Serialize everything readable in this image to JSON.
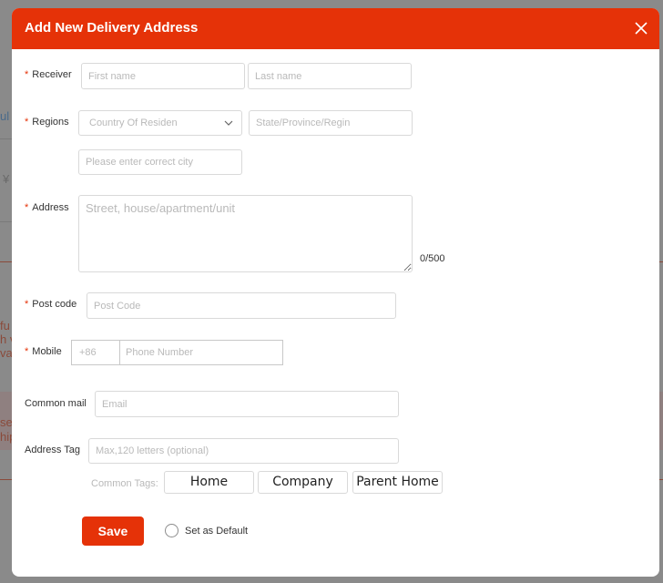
{
  "background": {
    "fragments": [
      "ul",
      "¥",
      "fu",
      "h v",
      "va",
      "se",
      "hip"
    ]
  },
  "modal": {
    "title": "Add New Delivery Address",
    "close_icon": "close-icon",
    "required_mark": "*",
    "receiver": {
      "label": "Receiver",
      "first_name_placeholder": "First name",
      "last_name_placeholder": "Last name"
    },
    "regions": {
      "label": "Regions",
      "country_placeholder": "Country Of Residen",
      "state_placeholder": "State/Province/Regin",
      "city_placeholder": "Please enter correct city"
    },
    "address": {
      "label": "Address",
      "placeholder": "Street, house/apartment/unit",
      "counter": "0/500"
    },
    "postcode": {
      "label": "Post code",
      "placeholder": "Post Code"
    },
    "mobile": {
      "label": "Mobile",
      "prefix_placeholder": "+86",
      "number_placeholder": "Phone Number"
    },
    "email": {
      "label": "Common mail",
      "placeholder": "Email"
    },
    "address_tag": {
      "label": "Address Tag",
      "placeholder": "Max,120 letters (optional)",
      "common_tags_label": "Common Tags:",
      "tags": [
        "Home",
        "Company",
        "Parent Home"
      ]
    },
    "save_label": "Save",
    "default_label": "Set as Default",
    "default_checked": false
  },
  "colors": {
    "accent": "#e53208",
    "overlay": "#8a8a8a"
  }
}
